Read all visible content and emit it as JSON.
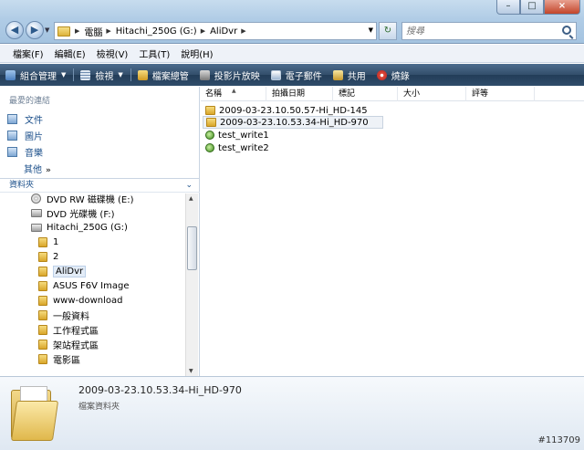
{
  "window": {
    "minimize": "–",
    "maximize": "□",
    "close": "×"
  },
  "nav": {
    "back": "◀",
    "forward": "▶"
  },
  "address": {
    "crumbs": [
      "電腦",
      "Hitachi_250G (G:)",
      "AliDvr"
    ],
    "refresh": "↻"
  },
  "search": {
    "placeholder": "搜尋"
  },
  "menu": [
    "檔案(F)",
    "編輯(E)",
    "檢視(V)",
    "工具(T)",
    "說明(H)"
  ],
  "toolbar": [
    "組合管理",
    "檢視",
    "檔案總管",
    "投影片放映",
    "電子郵件",
    "共用",
    "燒錄"
  ],
  "favorites": {
    "header": "最愛的連結",
    "links": [
      "文件",
      "圖片",
      "音樂"
    ],
    "more": "其他",
    "more_glyph": "»"
  },
  "folders": {
    "header": "資料夾",
    "chevron": "⌄",
    "items": [
      "DVD RW 磁碟機 (E:)",
      "DVD 光碟機 (F:)",
      "Hitachi_250G (G:)",
      "1",
      "2",
      "AliDvr",
      "ASUS F6V Image",
      "www-download",
      "一般資料",
      "工作程式區",
      "架站程式區",
      "電影區"
    ]
  },
  "columns": [
    "名稱",
    "拍攝日期",
    "標記",
    "大小",
    "評等"
  ],
  "files": [
    {
      "name": "2009-03-23.10.50.57-Hi_HD-145",
      "type": "folder"
    },
    {
      "name": "2009-03-23.10.53.34-Hi_HD-970",
      "type": "folder",
      "selected": true
    },
    {
      "name": "test_write1",
      "type": "file"
    },
    {
      "name": "test_write2",
      "type": "file"
    }
  ],
  "details": {
    "name": "2009-03-23.10.53.34-Hi_HD-970",
    "type": "檔案資料夾"
  },
  "watermark": "#113709",
  "colors": {
    "toolbar": "#334e6b",
    "titlebar": "#b0cce6",
    "link": "#1b4f8a"
  }
}
